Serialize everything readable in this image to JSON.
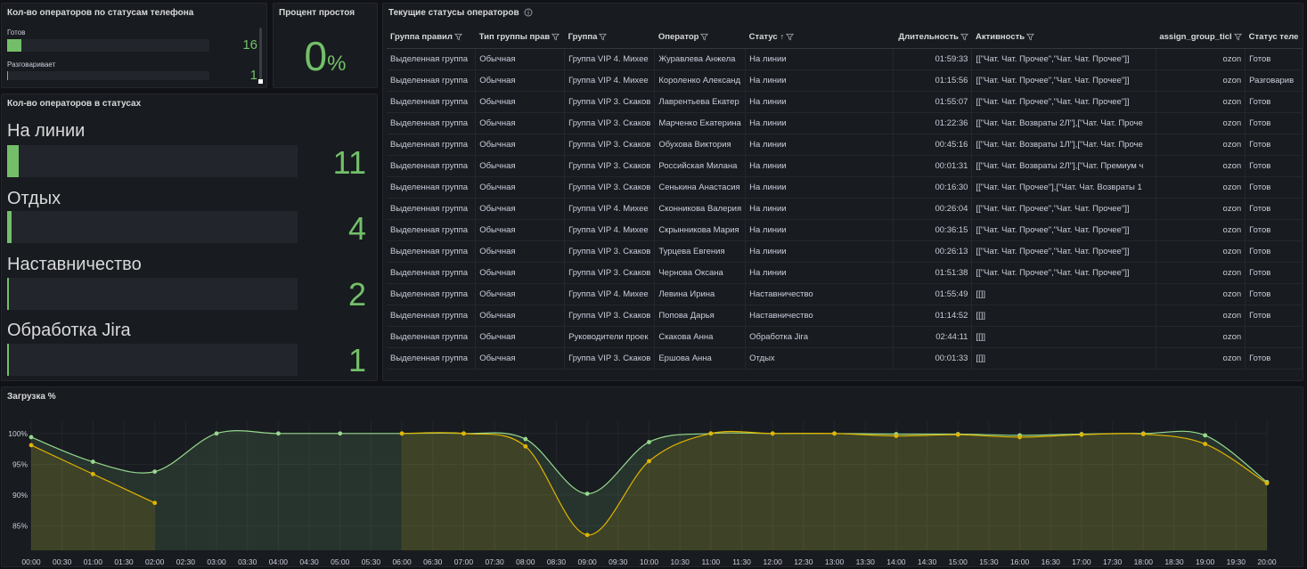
{
  "phone_panel": {
    "title": "Кол-во операторов по статусам телефона",
    "rows": [
      {
        "label": "Готов",
        "value": "16",
        "fraction": 0.07
      },
      {
        "label": "Разговаривает",
        "value": "1",
        "fraction": 0.0
      }
    ]
  },
  "idle_panel": {
    "title": "Процент простоя",
    "value": "0",
    "unit": "%"
  },
  "status_panel": {
    "title": "Кол-во операторов в статусах",
    "rows": [
      {
        "label": "На линии",
        "value": "11",
        "fraction": 0.04
      },
      {
        "label": "Отдых",
        "value": "4",
        "fraction": 0.015
      },
      {
        "label": "Наставничество",
        "value": "2",
        "fraction": 0.007
      },
      {
        "label": "Обработка Jira",
        "value": "1",
        "fraction": 0.003
      }
    ]
  },
  "table_panel": {
    "title": "Текущие статусы операторов",
    "columns": [
      "Группа правил",
      "Тип группы прав",
      "Группа",
      "Оператор",
      "Статус",
      "Длительность",
      "Активность",
      "assign_group_ticl",
      "Статус теле"
    ],
    "rows": [
      [
        "Выделенная группа",
        "Обычная",
        "Группа VIP 4. Михее",
        "Журавлева Анжела",
        "На линии",
        "01:59:33",
        "[[\"Чат. Чат. Прочее\",\"Чат. Чат. Прочее\"]]",
        "ozon",
        "Готов"
      ],
      [
        "Выделенная группа",
        "Обычная",
        "Группа VIP 4. Михее",
        "Короленко Александ",
        "На линии",
        "01:15:56",
        "[[\"Чат. Чат. Прочее\",\"Чат. Чат. Прочее\"]]",
        "ozon",
        "Разговарив"
      ],
      [
        "Выделенная группа",
        "Обычная",
        "Группа VIP 3. Скаков",
        "Лаврентьева Екатер",
        "На линии",
        "01:55:07",
        "[[\"Чат. Чат. Прочее\",\"Чат. Чат. Прочее\"]]",
        "ozon",
        "Готов"
      ],
      [
        "Выделенная группа",
        "Обычная",
        "Группа VIP 3. Скаков",
        "Марченко Екатерина",
        "На линии",
        "01:22:36",
        "[[\"Чат. Чат. Возвраты 2Л\"],[\"Чат. Чат. Проче",
        "ozon",
        "Готов"
      ],
      [
        "Выделенная группа",
        "Обычная",
        "Группа VIP 3. Скаков",
        "Обухова Виктория",
        "На линии",
        "00:45:16",
        "[[\"Чат. Чат. Возвраты 1Л\"],[\"Чат. Чат. Проче",
        "ozon",
        "Готов"
      ],
      [
        "Выделенная группа",
        "Обычная",
        "Группа VIP 3. Скаков",
        "Российская Милана",
        "На линии",
        "00:01:31",
        "[[\"Чат. Чат. Возвраты 2Л\"],[\"Чат. Премиум ч",
        "ozon",
        "Готов"
      ],
      [
        "Выделенная группа",
        "Обычная",
        "Группа VIP 3. Скаков",
        "Сенькина Анастасия",
        "На линии",
        "00:16:30",
        "[[\"Чат. Чат. Прочее\"],[\"Чат. Чат. Возвраты 1",
        "ozon",
        "Готов"
      ],
      [
        "Выделенная группа",
        "Обычная",
        "Группа VIP 4. Михее",
        "Сконникова Валерия",
        "На линии",
        "00:26:04",
        "[[\"Чат. Чат. Прочее\",\"Чат. Чат. Прочее\"]]",
        "ozon",
        "Готов"
      ],
      [
        "Выделенная группа",
        "Обычная",
        "Группа VIP 4. Михее",
        "Скрынникова Мария",
        "На линии",
        "00:36:15",
        "[[\"Чат. Чат. Прочее\",\"Чат. Чат. Прочее\"]]",
        "ozon",
        "Готов"
      ],
      [
        "Выделенная группа",
        "Обычная",
        "Группа VIP 3. Скаков",
        "Турцева Евгения",
        "На линии",
        "00:26:13",
        "[[\"Чат. Чат. Прочее\",\"Чат. Чат. Прочее\"]]",
        "ozon",
        "Готов"
      ],
      [
        "Выделенная группа",
        "Обычная",
        "Группа VIP 3. Скаков",
        "Чернова Оксана",
        "На линии",
        "01:51:38",
        "[[\"Чат. Чат. Прочее\",\"Чат. Чат. Прочее\"]]",
        "ozon",
        "Готов"
      ],
      [
        "Выделенная группа",
        "Обычная",
        "Группа VIP 4. Михее",
        "Левина Ирина",
        "Наставничество",
        "01:55:49",
        "[[]]",
        "ozon",
        "Готов"
      ],
      [
        "Выделенная группа",
        "Обычная",
        "Группа VIP 3. Скаков",
        "Попова Дарья",
        "Наставничество",
        "01:14:52",
        "[[]]",
        "ozon",
        "Готов"
      ],
      [
        "Выделенная группа",
        "Обычная",
        "Руководители проек",
        "Скакова Анна",
        "Обработка Jira",
        "02:44:11",
        "[[]]",
        "ozon",
        ""
      ],
      [
        "Выделенная группа",
        "Обычная",
        "Группа VIP 3. Скаков",
        "Ершова Анна",
        "Отдых",
        "00:01:33",
        "[[]]",
        "ozon",
        "Готов"
      ]
    ]
  },
  "chart_panel": {
    "title": "Загрузка %"
  },
  "colors": {
    "green": "#73bf69",
    "yellow": "#fade2a",
    "series_a": "#96d98d",
    "series_b": "#e0b400",
    "background": "#111217",
    "panel": "#181b1f"
  },
  "chart_data": {
    "type": "area",
    "x": [
      "00:00",
      "00:30",
      "01:00",
      "01:30",
      "02:00",
      "02:30",
      "03:00",
      "03:30",
      "04:00",
      "04:30",
      "05:00",
      "05:30",
      "06:00",
      "06:30",
      "07:00",
      "07:30",
      "08:00",
      "08:30",
      "09:00",
      "09:30",
      "10:00",
      "10:30",
      "11:00",
      "11:30",
      "12:00",
      "12:30",
      "13:00",
      "13:30",
      "14:00",
      "14:30",
      "15:00",
      "15:30",
      "16:00",
      "16:30",
      "17:00",
      "17:30",
      "18:00",
      "18:30",
      "19:00",
      "19:30",
      "20:00"
    ],
    "y_ticks": [
      "85%",
      "90%",
      "95%",
      "100%"
    ],
    "ylim": [
      81,
      102
    ],
    "series": [
      {
        "color": "#96d98d",
        "points": [
          [
            0,
            99.4
          ],
          [
            1,
            95.4
          ],
          [
            2,
            93.8
          ],
          [
            3,
            100
          ],
          [
            4,
            100
          ],
          [
            5,
            100
          ],
          [
            6,
            100
          ],
          [
            7,
            100
          ],
          [
            8,
            99.1
          ],
          [
            9,
            90.2
          ],
          [
            10,
            98.6
          ],
          [
            11,
            100
          ],
          [
            12,
            100
          ],
          [
            13,
            100
          ],
          [
            14,
            99.9
          ],
          [
            15,
            99.9
          ],
          [
            16,
            99.7
          ],
          [
            17,
            99.9
          ],
          [
            18,
            100
          ],
          [
            19,
            99.7
          ],
          [
            20,
            92.1
          ]
        ]
      },
      {
        "color": "#e0b400",
        "points": [
          [
            0,
            98.1
          ],
          [
            1,
            93.4
          ],
          [
            2,
            88.7
          ]
        ]
      },
      {
        "color": "#e0b400",
        "points": [
          [
            6,
            100
          ],
          [
            7,
            100
          ],
          [
            8,
            97.9
          ],
          [
            9,
            83.5
          ],
          [
            10,
            95.5
          ],
          [
            11,
            100
          ],
          [
            12,
            100
          ],
          [
            13,
            100
          ],
          [
            14,
            99.6
          ],
          [
            15,
            99.8
          ],
          [
            16,
            99.4
          ],
          [
            17,
            99.8
          ],
          [
            18,
            99.9
          ],
          [
            19,
            98.3
          ],
          [
            20,
            91.9
          ]
        ]
      }
    ]
  }
}
